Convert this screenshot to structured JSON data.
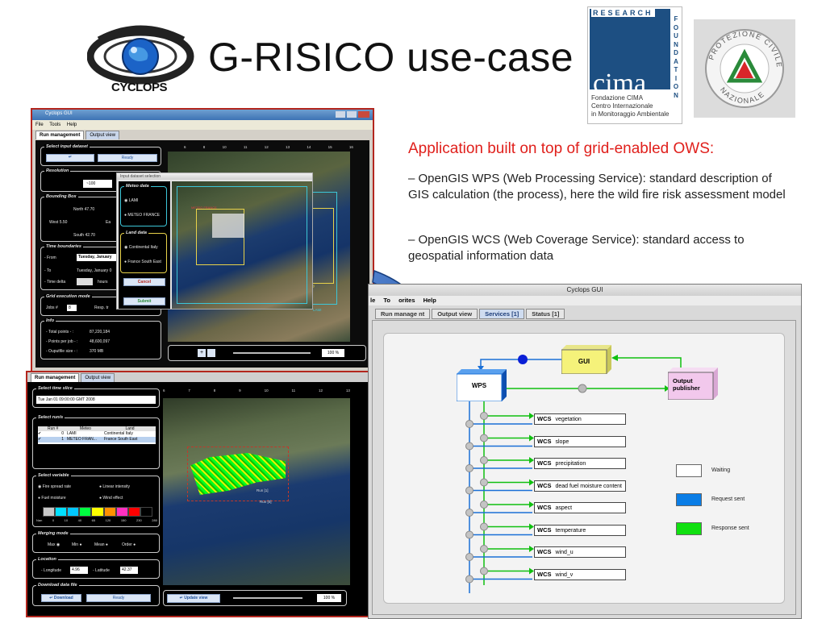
{
  "slide": {
    "title": "G-RISICO use-case",
    "cyclops_logo_text": "CYCLOPS",
    "lead": "Application built on top of grid-enabled OWS:",
    "bullets": [
      "–  OpenGIS WPS (Web Processing Service): standard description of GIS calculation (the process), here the wild fire risk assessment model",
      "–  OpenGIS WCS (Web Coverage Service): standard access to geospatial information data"
    ]
  },
  "logos": {
    "cima": {
      "top": "RESEARCH",
      "side": "FOUNDATION",
      "word": "cima",
      "caption": [
        "Fondazione CIMA",
        "Centro Internazionale",
        "in Monitoraggio Ambientale"
      ]
    },
    "protezione": {
      "text": "PROTEZIONE CIVILE NAZIONALE"
    }
  },
  "colors": {
    "lead_red": "#e0201c",
    "wps_blue": "#1a6fd6",
    "gui_yellow": "#f5f27a",
    "output_pink": "#f2c8ec",
    "response_green": "#10e010",
    "request_blue": "#0a7de6"
  },
  "win1": {
    "title": "Cyclops GUI",
    "menu": [
      "File",
      "Tools",
      "Help"
    ],
    "tabs": [
      "Run management",
      "Output view"
    ],
    "select_input": "Select input dataset",
    "ready": "Ready",
    "resolution": "Resolution",
    "res_value": "~100",
    "bounding_box": "Bounding Box",
    "north": "North  47.70",
    "west": "West  5.50",
    "east": "Ea",
    "south": "South  42.70",
    "time_boundaries": "Time boundaries",
    "from": "- From",
    "from_value": "Tuesday, January",
    "to": "- To",
    "to_value": "Tuesday, January 0",
    "time_delta": "- Time delta",
    "hours": "hours",
    "grid_mode": "Grid execution mode",
    "jobs": "Jobs #",
    "jobs_value": "8",
    "resp": "Resp. tr",
    "info": "Info",
    "total_points": "- Total points - :",
    "total_points_value": "87,220,184",
    "points_per_job": "- Points per job - :",
    "points_per_job_value": "48,600,097",
    "output_size": "- Ouputfile size - :",
    "output_size_value": "370 MB",
    "zoom": "100 %",
    "x_ticks": [
      "6",
      "8",
      "10",
      "11",
      "12",
      "13",
      "14",
      "15",
      "16"
    ],
    "dialog": {
      "title": "Input dataset selection",
      "meteo_title": "Meteo data",
      "meteo_options": [
        "LAMI",
        "METEO FRANCE"
      ],
      "land_title": "Land data",
      "land_options": [
        "Continental Italy",
        "France South East"
      ],
      "cancel": "Cancel",
      "submit": "Submit"
    },
    "map_labels": {
      "france": "France South East",
      "italy": "Continental Italy",
      "lami": "LAMI",
      "meteo": "METEO FRANCE"
    }
  },
  "win2": {
    "tabs": [
      "Run management",
      "Output view"
    ],
    "time_slice": "Select time slice",
    "time_value": "Tue Jan 01 09:00:00 GMT 2008",
    "select_runs": "Select run/s",
    "table_headers": [
      "Run #",
      "Meteo",
      "Land"
    ],
    "rows": [
      {
        "check": "✔",
        "run": "0",
        "meteo": "LAMI",
        "land": "Continental Italy"
      },
      {
        "check": "✔",
        "run": "1",
        "meteo": "METEO FRAN...",
        "land": "France South East"
      }
    ],
    "select_variable": "Select variable",
    "variables": [
      "Fire spread rate",
      "Linear intensity",
      "Fuel moisture",
      "Wind effect"
    ],
    "scale_labels": [
      "Nan",
      "0",
      "10",
      "40",
      "65",
      "120",
      "150",
      "230",
      "280"
    ],
    "scale_colors": [
      "#c8c8c8",
      "#00e0ff",
      "#00c8ff",
      "#00ff40",
      "#ffff00",
      "#ff9000",
      "#ff30c0",
      "#ff0000",
      "#000000"
    ],
    "merging_mode": "Merging mode",
    "merge_options": [
      "Max",
      "Min",
      "Mean",
      "Order"
    ],
    "location": "Location",
    "longitude": "- Longitude",
    "longitude_value": "4.96",
    "latitude": "- Latitude",
    "latitude_value": "42.37",
    "download": "Download data file",
    "download_btn": "Download",
    "ready": "Ready",
    "update_view": "Update view",
    "zoom": "100 %",
    "run_labels": [
      "Run [1]",
      "Run [0]"
    ],
    "x_ticks": [
      "6",
      "7",
      "8",
      "9",
      "10",
      "11",
      "12",
      "13"
    ]
  },
  "cyclops": {
    "title": "Cyclops GUI",
    "menu": [
      "le",
      "To",
      "orites",
      "Help"
    ],
    "tabs": [
      "Run manage",
      "nt",
      "Output view",
      "Services [1]",
      "Status [1]"
    ],
    "wps": "WPS",
    "gui": "GUI",
    "output": "Output publisher",
    "wcs_label": "WCS",
    "services": [
      "vegetation",
      "slope",
      "precipitation",
      "dead fuel moisture content",
      "aspect",
      "temperature",
      "wind_u",
      "wind_v"
    ],
    "legend": [
      {
        "label": "Waiting",
        "color": "#ffffff"
      },
      {
        "label": "Request sent",
        "color": "#0a7de6"
      },
      {
        "label": "Response sent",
        "color": "#10e010"
      }
    ]
  }
}
